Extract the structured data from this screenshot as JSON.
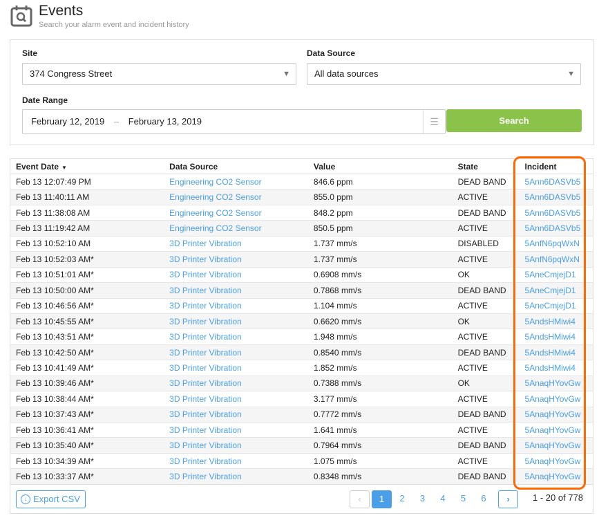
{
  "header": {
    "title": "Events",
    "subtitle": "Search your alarm event and incident history",
    "icon": "calendar-search-icon"
  },
  "filters": {
    "site_label": "Site",
    "site_value": "374 Congress Street",
    "source_label": "Data Source",
    "source_value": "All data sources",
    "date_label": "Date Range",
    "date_start": "February 12, 2019",
    "date_sep": "–",
    "date_end": "February 13, 2019",
    "search_label": "Search"
  },
  "table": {
    "columns": [
      "Event Date",
      "Data Source",
      "Value",
      "State",
      "Incident"
    ],
    "sort_indicator": "▼",
    "rows": [
      [
        "Feb 13 12:07:49 PM",
        "Engineering CO2 Sensor",
        "846.6 ppm",
        "DEAD BAND",
        "5Ann6DASVb5"
      ],
      [
        "Feb 13 11:40:11 AM",
        "Engineering CO2 Sensor",
        "855.0 ppm",
        "ACTIVE",
        "5Ann6DASVb5"
      ],
      [
        "Feb 13 11:38:08 AM",
        "Engineering CO2 Sensor",
        "848.2 ppm",
        "DEAD BAND",
        "5Ann6DASVb5"
      ],
      [
        "Feb 13 11:19:42 AM",
        "Engineering CO2 Sensor",
        "850.5 ppm",
        "ACTIVE",
        "5Ann6DASVb5"
      ],
      [
        "Feb 13 10:52:10 AM",
        "3D Printer Vibration",
        "1.737 mm/s",
        "DISABLED",
        "5AnfN6pqWxN"
      ],
      [
        "Feb 13 10:52:03 AM*",
        "3D Printer Vibration",
        "1.737 mm/s",
        "ACTIVE",
        "5AnfN6pqWxN"
      ],
      [
        "Feb 13 10:51:01 AM*",
        "3D Printer Vibration",
        "0.6908 mm/s",
        "OK",
        "5AneCmjejD1"
      ],
      [
        "Feb 13 10:50:00 AM*",
        "3D Printer Vibration",
        "0.7868 mm/s",
        "DEAD BAND",
        "5AneCmjejD1"
      ],
      [
        "Feb 13 10:46:56 AM*",
        "3D Printer Vibration",
        "1.104 mm/s",
        "ACTIVE",
        "5AneCmjejD1"
      ],
      [
        "Feb 13 10:45:55 AM*",
        "3D Printer Vibration",
        "0.6620 mm/s",
        "OK",
        "5AndsHMiwi4"
      ],
      [
        "Feb 13 10:43:51 AM*",
        "3D Printer Vibration",
        "1.948 mm/s",
        "ACTIVE",
        "5AndsHMiwi4"
      ],
      [
        "Feb 13 10:42:50 AM*",
        "3D Printer Vibration",
        "0.8540 mm/s",
        "DEAD BAND",
        "5AndsHMiwi4"
      ],
      [
        "Feb 13 10:41:49 AM*",
        "3D Printer Vibration",
        "1.852 mm/s",
        "ACTIVE",
        "5AndsHMiwi4"
      ],
      [
        "Feb 13 10:39:46 AM*",
        "3D Printer Vibration",
        "0.7388 mm/s",
        "OK",
        "5AnaqHYovGw"
      ],
      [
        "Feb 13 10:38:44 AM*",
        "3D Printer Vibration",
        "3.177 mm/s",
        "ACTIVE",
        "5AnaqHYovGw"
      ],
      [
        "Feb 13 10:37:43 AM*",
        "3D Printer Vibration",
        "0.7772 mm/s",
        "DEAD BAND",
        "5AnaqHYovGw"
      ],
      [
        "Feb 13 10:36:41 AM*",
        "3D Printer Vibration",
        "1.641 mm/s",
        "ACTIVE",
        "5AnaqHYovGw"
      ],
      [
        "Feb 13 10:35:40 AM*",
        "3D Printer Vibration",
        "0.7964 mm/s",
        "DEAD BAND",
        "5AnaqHYovGw"
      ],
      [
        "Feb 13 10:34:39 AM*",
        "3D Printer Vibration",
        "1.075 mm/s",
        "ACTIVE",
        "5AnaqHYovGw"
      ],
      [
        "Feb 13 10:33:37 AM*",
        "3D Printer Vibration",
        "0.8348 mm/s",
        "DEAD BAND",
        "5AnaqHYovGw"
      ]
    ]
  },
  "footer": {
    "export_label": "Export CSV",
    "pages": [
      "1",
      "2",
      "3",
      "4",
      "5",
      "6"
    ],
    "current_page": "1",
    "count": "1 - 20 of 778"
  },
  "colors": {
    "accent": "#4a9fe8",
    "search": "#8bc34a",
    "highlight": "#ff6a00"
  }
}
